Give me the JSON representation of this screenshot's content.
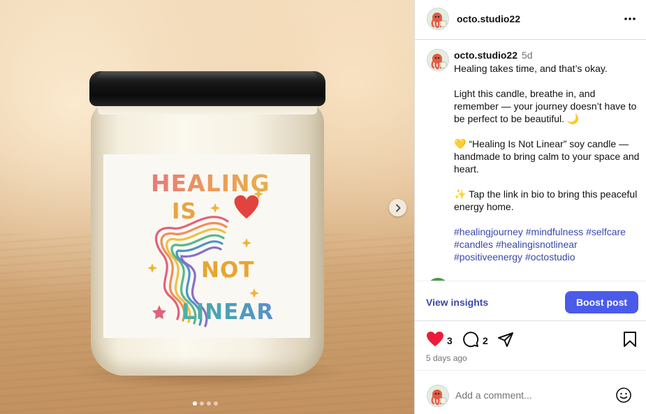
{
  "photo": {
    "label_lines": [
      "HEALING",
      "IS",
      "NOT",
      "LINEAR"
    ],
    "carousel_total": 4,
    "carousel_active": 1
  },
  "post": {
    "username": "octo.studio22",
    "age": "5d",
    "caption": [
      "Healing takes time, and that’s okay.",
      "Light this candle, breathe in, and remember — your journey doesn’t have to be perfect to be beautiful. 🌙",
      "💛 “Healing Is Not Linear” soy candle — handmade to bring calm to your space and heart.",
      "✨ Tap the link in bio to bring this peaceful energy home."
    ],
    "hashtags": [
      "#healingjourney",
      "#mindfulness",
      "#selfcare",
      "#candles",
      "#healingisnotlinear",
      "#positiveenergy",
      "#octostudio"
    ]
  },
  "insights": {
    "view_label": "View insights",
    "boost_label": "Boost post"
  },
  "engagement": {
    "likes": "3",
    "comments": "2",
    "time_ago": "5 days ago"
  },
  "comment_box": {
    "placeholder": "Add a comment..."
  },
  "colors": {
    "accent": "#4a5bea",
    "link": "#3949ab",
    "like": "#ed1c3a",
    "muted": "#737373"
  },
  "icons": [
    "more-icon",
    "chevron-right-icon",
    "heart-icon",
    "comment-icon",
    "share-icon",
    "bookmark-icon",
    "emoji-icon"
  ]
}
